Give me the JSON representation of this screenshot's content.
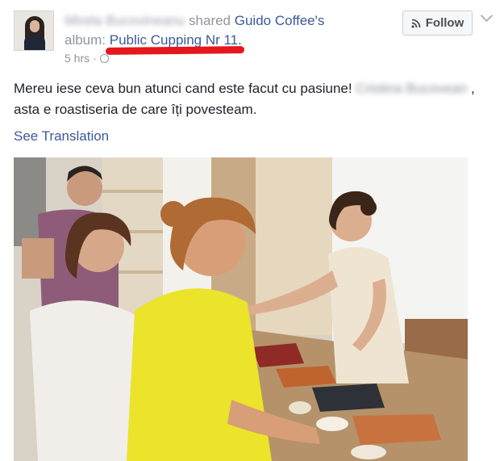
{
  "post": {
    "author_name": "Mirela Bucovineanu",
    "shared_text": " shared ",
    "page_name": "Guido Coffee",
    "possessive": "'s",
    "album_prefix": "album: ",
    "album_name": "Public Cupping Nr 11",
    "album_suffix": ".",
    "time": "5 hrs",
    "time_separator": "·",
    "follow_label": "Follow",
    "text_before": "Mereu iese ceva bun atunci cand este facut cu pasiune! ",
    "mentioned_name": "Cristina Bucovean",
    "text_after": " , asta e roastiseria de care îți povesteam.",
    "see_translation": "See Translation"
  },
  "icons": {
    "avatar": "profile-photo",
    "follow": "rss-icon",
    "menu": "chevron-down-icon",
    "privacy": "globe-icon"
  },
  "colors": {
    "link": "#3b5998",
    "meta": "#90949c",
    "text": "#1d2129",
    "annotation": "#e6161d"
  }
}
